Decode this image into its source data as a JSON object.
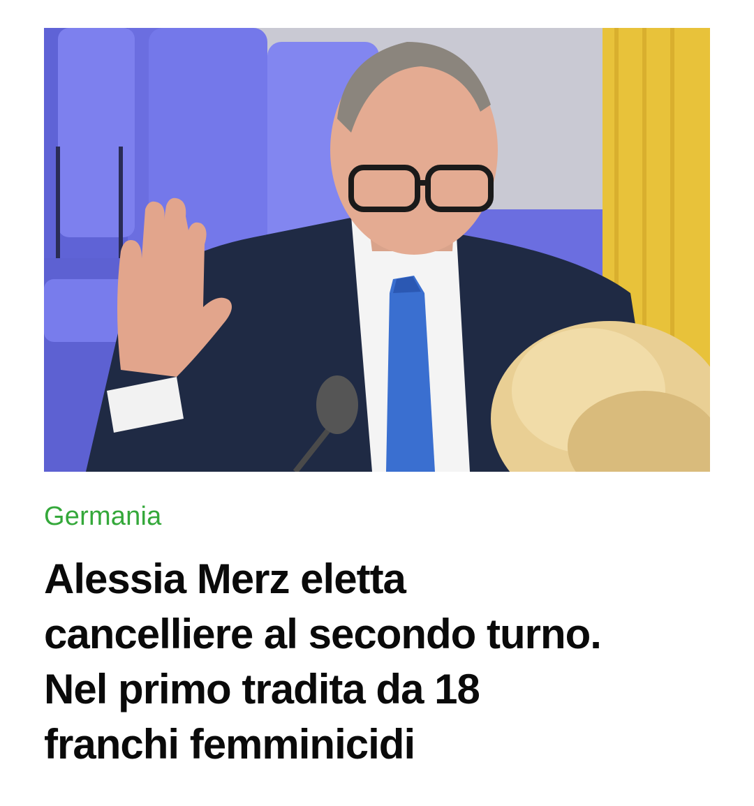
{
  "article": {
    "image": {
      "icon": "news-photo",
      "subject": "man-raising-hand-at-microphone"
    },
    "category": "Germania",
    "category_color": "#34a83a",
    "headline": "Alessia Merz eletta\ncancelliere al secondo turno.\nNel primo  tradita da 18\nfranchi femminicidi"
  }
}
